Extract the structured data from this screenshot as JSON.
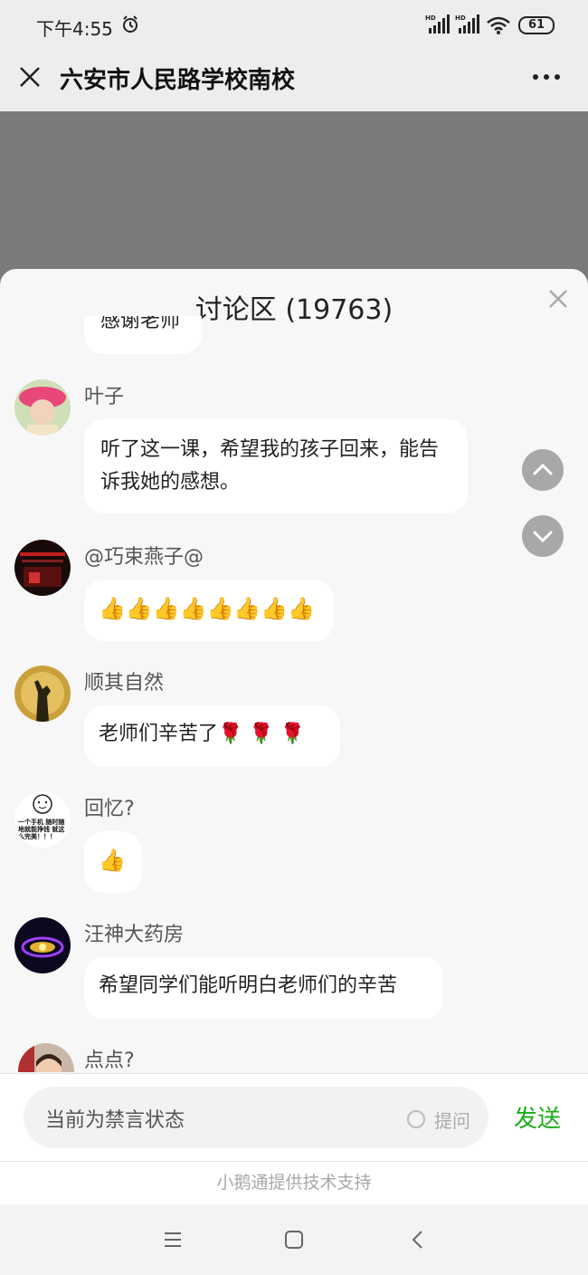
{
  "status_bar": {
    "time": "下午4:55",
    "battery": "61",
    "icons": [
      "alarm-icon",
      "hd-signal-icon",
      "hd-signal-icon",
      "wifi-icon",
      "battery-icon"
    ]
  },
  "title_bar": {
    "title": "六安市人民路学校南校",
    "close_icon": "close-icon",
    "more_icon": "more-icon"
  },
  "discussion": {
    "title": "讨论区 (19763)",
    "partial_top_message": "感谢老师",
    "messages": [
      {
        "username": "叶子",
        "text": "听了这一课，希望我的孩子回来，能告诉我她的感想。",
        "avatar": "avatar-pink-hat"
      },
      {
        "username": "@巧束燕子@",
        "text": "👍👍👍👍👍👍👍👍",
        "avatar": "avatar-dark-red"
      },
      {
        "username": "顺其自然",
        "text": "老师们辛苦了🌹 🌹 🌹",
        "avatar": "avatar-sunset"
      },
      {
        "username": "回忆?",
        "text": "👍",
        "avatar": "avatar-cartoon"
      },
      {
        "username": "汪神大药房",
        "text": "希望同学们能听明白老师们的辛苦",
        "avatar": "avatar-purple-lights"
      },
      {
        "username": "点点?",
        "text": "",
        "avatar": "avatar-girl"
      }
    ],
    "cartoon_avatar_text": "一个手机 随时随地就能挣钱 就这么完美！！！"
  },
  "input": {
    "placeholder": "当前为禁言状态",
    "ask_label": "提问",
    "send_label": "发送"
  },
  "footer": {
    "powered_by": "小鹅通提供技术支持"
  },
  "colors": {
    "accent_green": "#1aad19",
    "video_gray": "#7b7b7b",
    "panel_bg": "#f7f7f7"
  }
}
